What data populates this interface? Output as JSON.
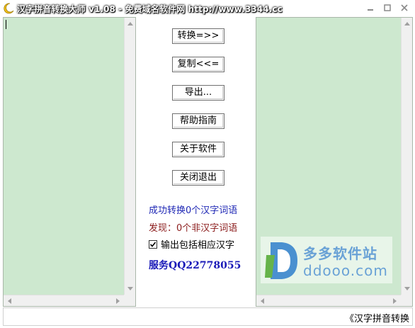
{
  "window": {
    "title": "汉字拼音转换大师 v1.08 - 免费域名软件网 http://www.3344.cc",
    "icon": "moon-icon",
    "controls": [
      "minimize-icon",
      "restore-icon",
      "close-icon"
    ]
  },
  "input_pane": {
    "value": ""
  },
  "output_pane": {
    "value": ""
  },
  "buttons": {
    "convert": "转换=>>",
    "copy": "复制<<=",
    "export": "导出...",
    "help": "帮助指南",
    "about": "关于软件",
    "close": "关闭退出"
  },
  "status": {
    "converted": "成功转换0个汉字词语",
    "found": "发现：0个非汉字词语"
  },
  "option": {
    "label": "输出包括相应汉字",
    "checked": true
  },
  "service": "服务QQ22778055",
  "watermark": {
    "cn": "多多软件站",
    "en": "ddooo.com"
  },
  "statusbar": {
    "text": "《汉字拼音转换"
  },
  "colors": {
    "pane_bg": "#cde8cf",
    "status_converted": "#1f28b5",
    "status_found": "#8b1c1c",
    "service": "#1a1ab8",
    "watermark": "#6aa2d6"
  }
}
